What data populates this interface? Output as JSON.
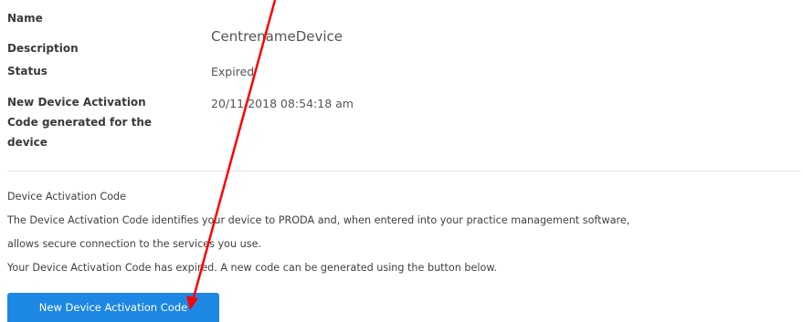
{
  "fields": {
    "name_label": "Name",
    "name_value": "CentrenameDevice",
    "description_label": "Description",
    "status_label": "Status",
    "status_value": "Expired",
    "new_code_label_line1": "New Device Activation",
    "new_code_label_line2": "Code generated for the",
    "new_code_label_line3": "device",
    "new_code_value": "20/11/2018 08:54:18 am"
  },
  "activation": {
    "heading": "Device Activation Code",
    "line1": "The Device Activation Code identifies your device to PRODA and, when entered into your practice management software,",
    "line2": "allows secure connection to the services you use.",
    "line3": "Your Device Activation Code has expired. A new code can be generated using the button below.",
    "button_label": "New Device Activation Code"
  },
  "annotation": {
    "arrow_color": "#ff0000"
  }
}
